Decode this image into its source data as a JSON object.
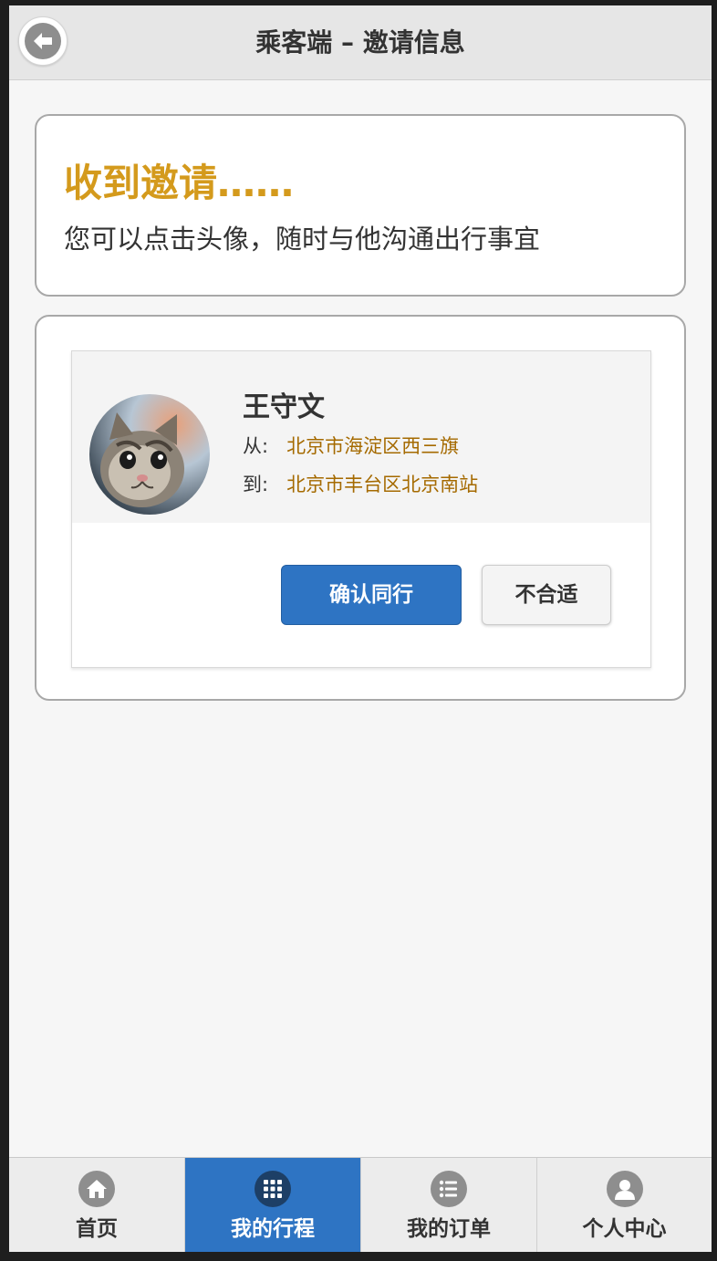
{
  "header": {
    "title": "乘客端 – 邀请信息",
    "back_icon": "arrow-left-icon"
  },
  "invite": {
    "title": "收到邀请……",
    "description": "您可以点击头像，随时与他沟通出行事宜"
  },
  "trip": {
    "driver_name": "王守文",
    "from_label": "从:",
    "from_place": "北京市海淀区西三旗",
    "to_label": "到:",
    "to_place": "北京市丰台区北京南站",
    "confirm_label": "确认同行",
    "reject_label": "不合适"
  },
  "tabbar": {
    "items": [
      {
        "label": "首页",
        "icon": "home-icon",
        "active": false
      },
      {
        "label": "我的行程",
        "icon": "grid-icon",
        "active": true
      },
      {
        "label": "我的订单",
        "icon": "list-icon",
        "active": false
      },
      {
        "label": "个人中心",
        "icon": "user-icon",
        "active": false
      }
    ]
  },
  "colors": {
    "accent": "#2e74c3",
    "title_gold": "#d49a1c",
    "place_brown": "#a56a00"
  }
}
